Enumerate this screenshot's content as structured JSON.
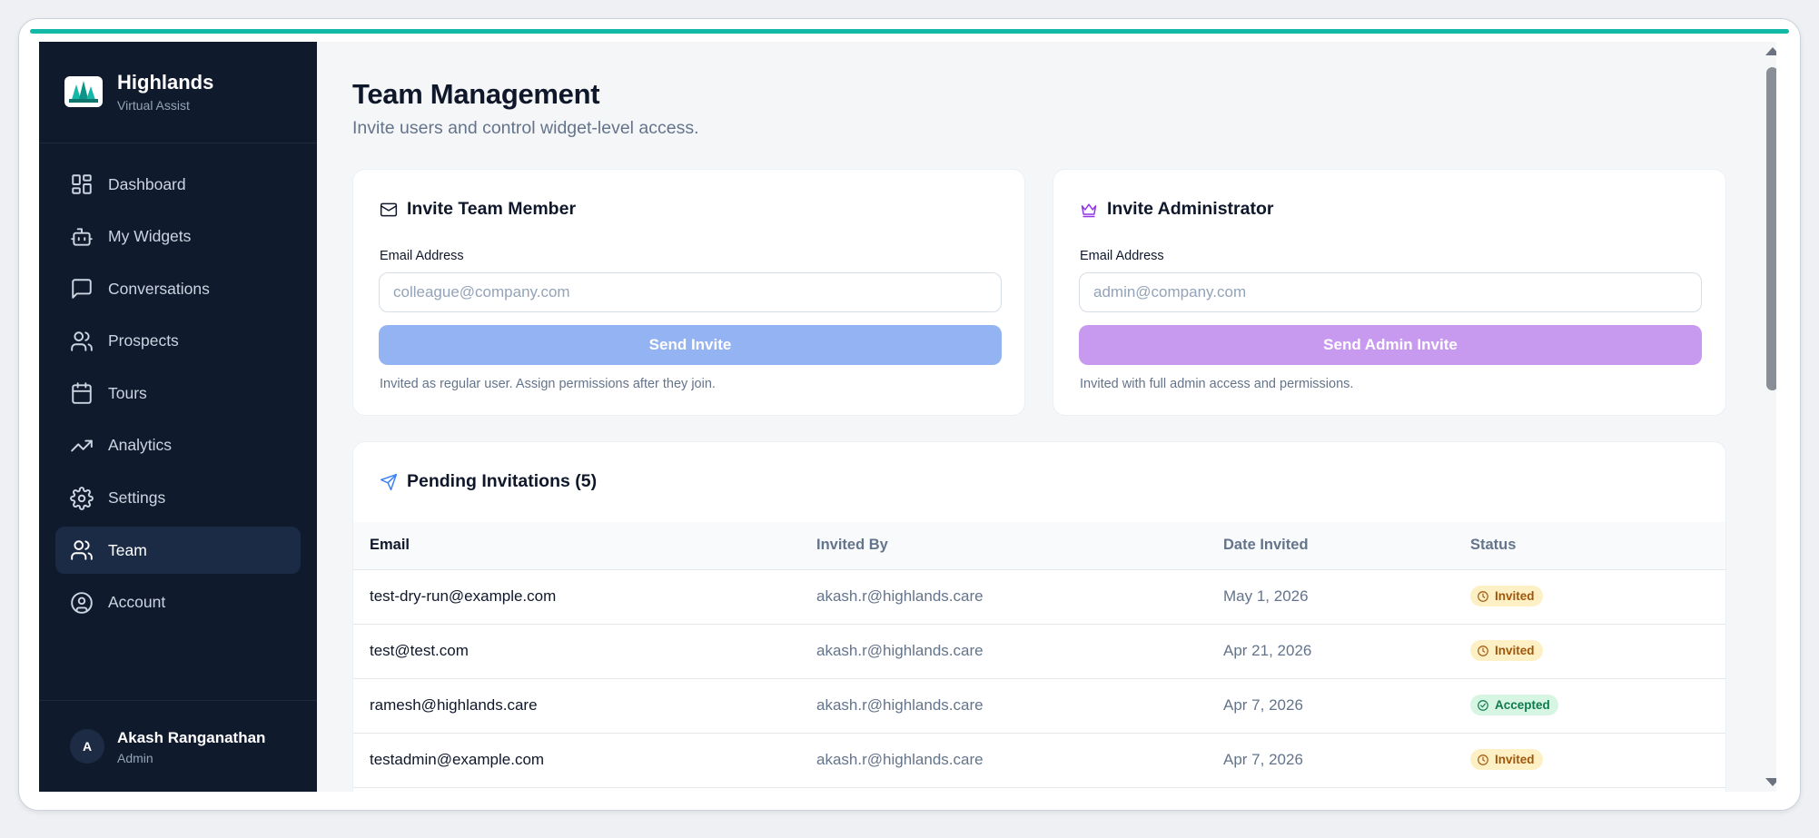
{
  "brand": {
    "name": "Highlands",
    "subtitle": "Virtual Assist",
    "logo_icon": "forest-logo-icon",
    "accent": "#14b8a6"
  },
  "sidebar": {
    "items": [
      {
        "label": "Dashboard",
        "icon": "dashboard-icon"
      },
      {
        "label": "My Widgets",
        "icon": "robot-icon"
      },
      {
        "label": "Conversations",
        "icon": "chat-bubble-icon"
      },
      {
        "label": "Prospects",
        "icon": "users-icon"
      },
      {
        "label": "Tours",
        "icon": "calendar-icon"
      },
      {
        "label": "Analytics",
        "icon": "trending-up-icon"
      },
      {
        "label": "Settings",
        "icon": "gear-icon"
      },
      {
        "label": "Team",
        "icon": "team-icon",
        "active": true
      },
      {
        "label": "Account",
        "icon": "user-circle-icon"
      }
    ],
    "user": {
      "initial": "A",
      "name": "Akash Ranganathan",
      "role": "Admin"
    }
  },
  "header": {
    "title": "Team Management",
    "subtitle": "Invite users and control widget-level access."
  },
  "invite_member": {
    "title": "Invite Team Member",
    "icon": "mail-icon",
    "email_label": "Email Address",
    "email_placeholder": "colleague@company.com",
    "email_value": "",
    "button_label": "Send Invite",
    "hint": "Invited as regular user. Assign permissions after they join.",
    "button_color": "#93b3f3"
  },
  "invite_admin": {
    "title": "Invite Administrator",
    "icon": "crown-icon",
    "email_label": "Email Address",
    "email_placeholder": "admin@company.com",
    "email_value": "",
    "button_label": "Send Admin Invite",
    "hint": "Invited with full admin access and permissions.",
    "button_color": "#c79af0"
  },
  "pending": {
    "title": "Pending Invitations (5)",
    "icon": "send-icon",
    "columns": [
      "Email",
      "Invited By",
      "Date Invited",
      "Status"
    ],
    "rows": [
      {
        "email": "test-dry-run@example.com",
        "invited_by": "akash.r@highlands.care",
        "date": "May 1, 2026",
        "status": "Invited"
      },
      {
        "email": "test@test.com",
        "invited_by": "akash.r@highlands.care",
        "date": "Apr 21, 2026",
        "status": "Invited"
      },
      {
        "email": "ramesh@highlands.care",
        "invited_by": "akash.r@highlands.care",
        "date": "Apr 7, 2026",
        "status": "Accepted"
      },
      {
        "email": "testadmin@example.com",
        "invited_by": "akash.r@highlands.care",
        "date": "Apr 7, 2026",
        "status": "Invited"
      }
    ],
    "status_colors": {
      "Invited": "#a1560b",
      "Accepted": "#0f7a4a"
    }
  }
}
